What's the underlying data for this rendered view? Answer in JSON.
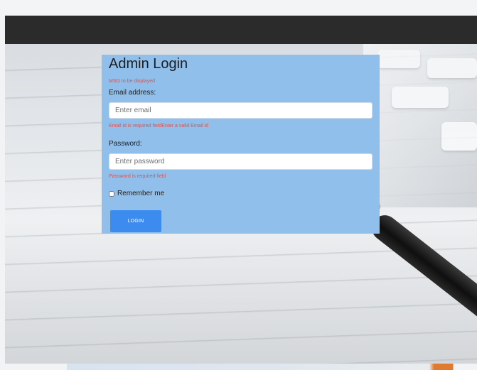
{
  "login": {
    "title": "Admin Login",
    "message": "MSG to be displayed",
    "email_label": "Email address:",
    "email_placeholder": "Enter email",
    "email_error": "Email id is required fieldEnter a valid Email id",
    "password_label": "Password:",
    "password_placeholder": "Enter password",
    "password_error": "Password is required field",
    "remember_label": "Remember me",
    "login_button": "LOGIN"
  },
  "colors": {
    "panel_bg": "#8fbfea",
    "navbar_bg": "#2b2b2b",
    "button_bg": "#3c8cf0",
    "error_text": "#e0524d"
  }
}
